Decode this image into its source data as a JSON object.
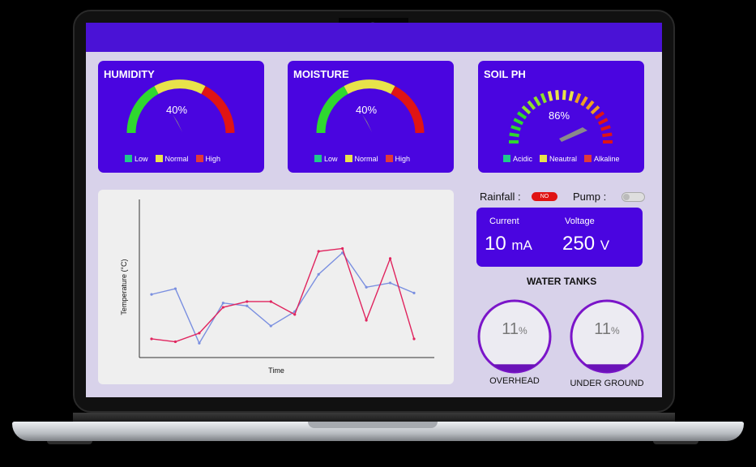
{
  "gauges": {
    "humidity": {
      "title": "HUMIDITY",
      "value": "40%",
      "level": 0.4,
      "legend": [
        "Low",
        "Normal",
        "High"
      ]
    },
    "moisture": {
      "title": "MOISTURE",
      "value": "40%",
      "level": 0.4,
      "legend": [
        "Low",
        "Normal",
        "High"
      ]
    },
    "soil_ph": {
      "title": "SOIL PH",
      "value": "86%",
      "level": 0.86,
      "legend": [
        "Acidic",
        "Neautral",
        "Alkaline"
      ]
    }
  },
  "legend_colors": {
    "low": "#1fc98a",
    "normal": "#e8e34a",
    "high": "#e03a3a"
  },
  "status": {
    "rainfall_label": "Rainfall :",
    "rainfall_toggle": "NO",
    "pump_label": "Pump :"
  },
  "power": {
    "current_label": "Current",
    "current_value": "10",
    "current_unit": "mA",
    "voltage_label": "Voltage",
    "voltage_value": "250",
    "voltage_unit": "V"
  },
  "tanks": {
    "title": "WATER TANKS",
    "overhead": {
      "value": "11",
      "unit": "%",
      "label": "OVERHEAD",
      "level": 0.11
    },
    "underground": {
      "value": "11",
      "unit": "%",
      "label": "UNDER GROUND",
      "level": 0.11
    }
  },
  "chart_data": {
    "type": "line",
    "xlabel": "Time",
    "ylabel": "Temperature (°C)",
    "x": [
      1,
      2,
      3,
      4,
      5,
      6,
      7,
      8,
      9,
      10,
      11,
      12
    ],
    "ylim": [
      0,
      100
    ],
    "grid": false,
    "series": [
      {
        "color": "#7a8fe0",
        "values": [
          44,
          48,
          10,
          38,
          36,
          22,
          32,
          58,
          73,
          49,
          52,
          45
        ]
      },
      {
        "color": "#e0245e",
        "values": [
          13,
          11,
          17,
          35,
          39,
          39,
          30,
          74,
          76,
          26,
          69,
          13
        ]
      }
    ]
  },
  "colors": {
    "accent": "#4a05e0",
    "screen_bg": "#d8d2ea"
  }
}
